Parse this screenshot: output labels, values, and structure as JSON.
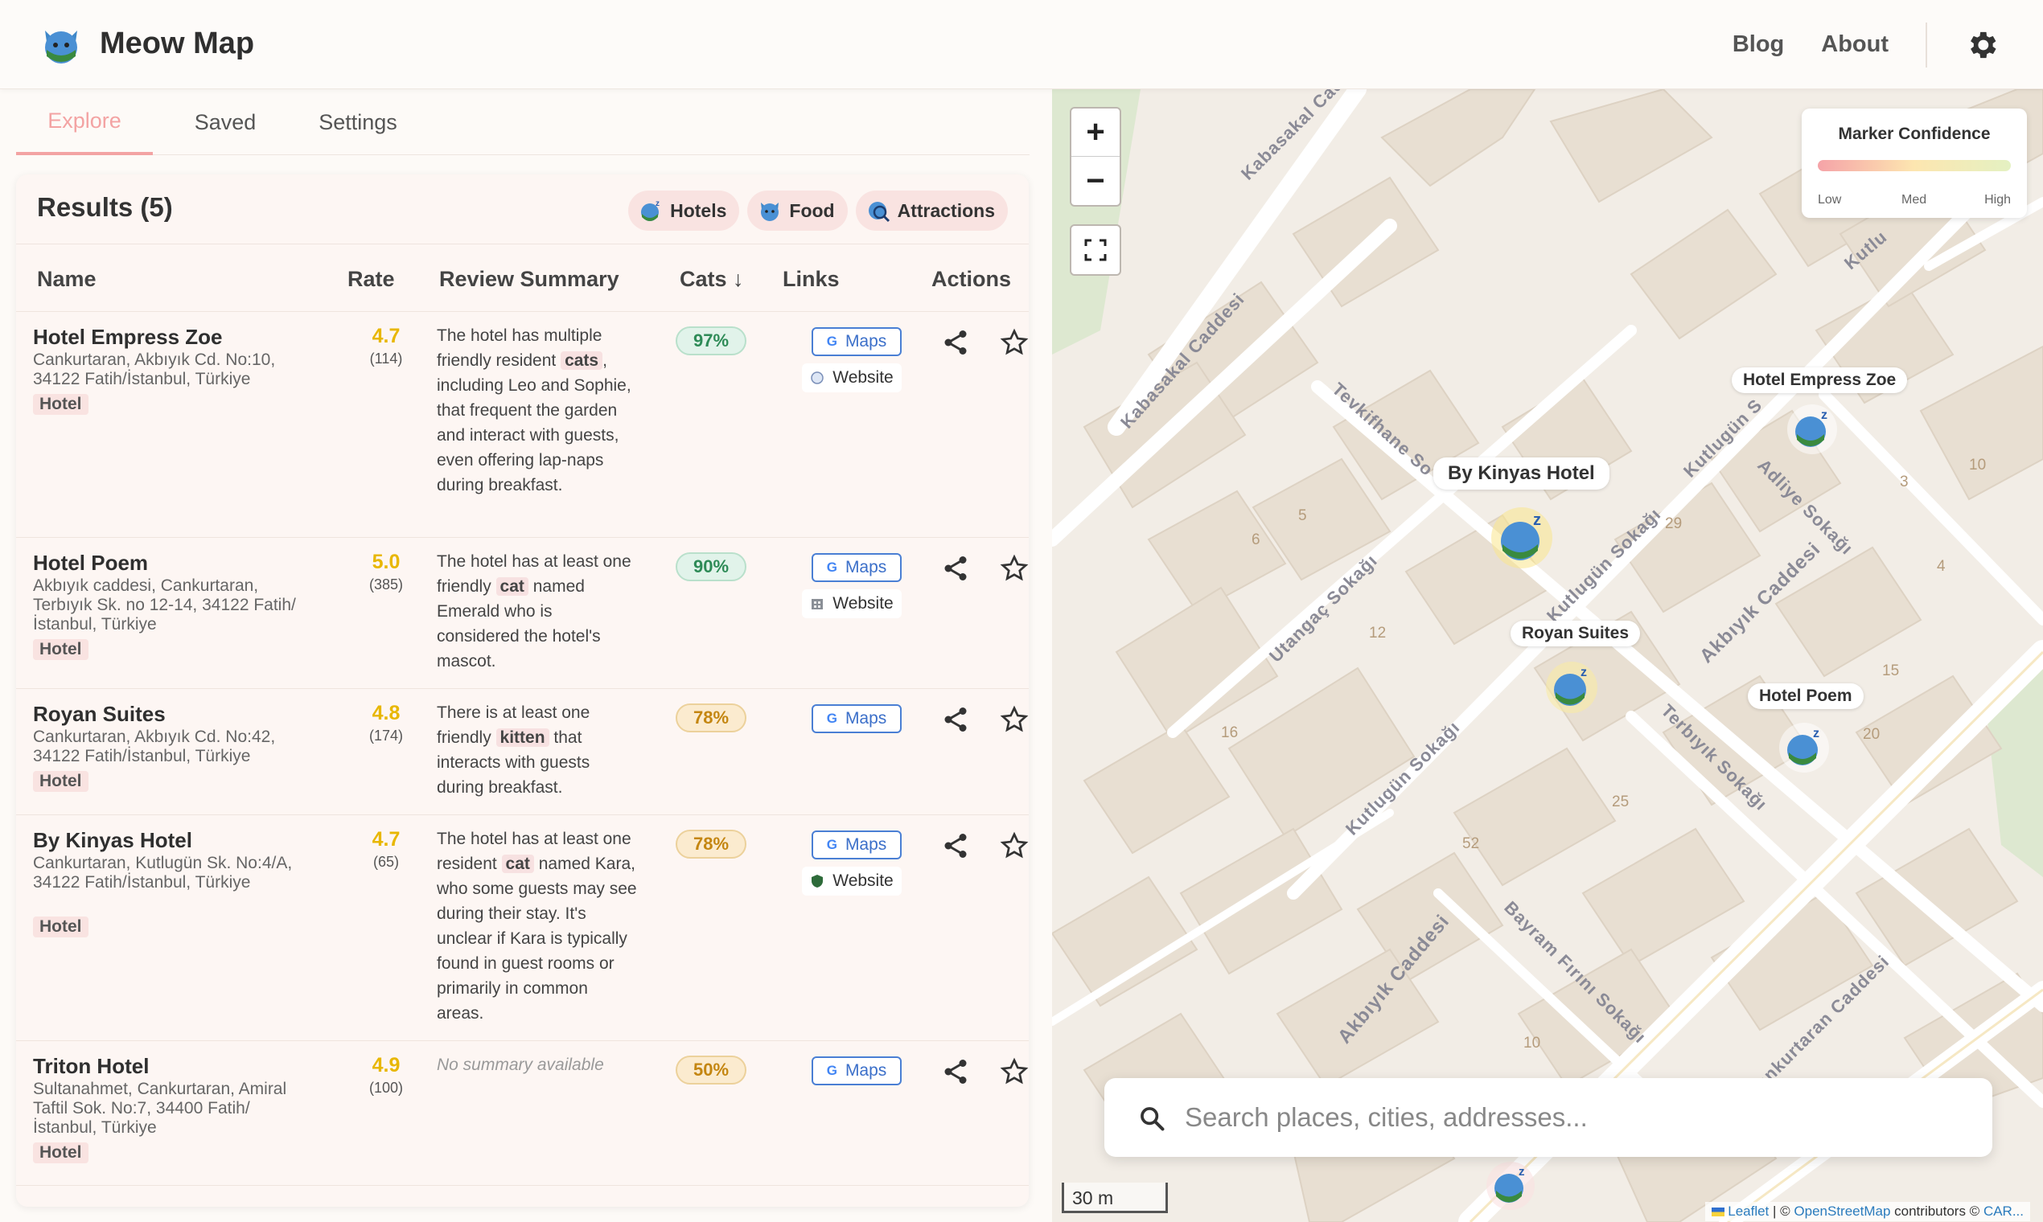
{
  "app": {
    "title": "Meow Map",
    "logo_icon": "cat-logo-icon"
  },
  "nav": {
    "blog": "Blog",
    "about": "About",
    "settings_icon": "gear-icon"
  },
  "tabs": [
    {
      "label": "Explore",
      "active": true
    },
    {
      "label": "Saved",
      "active": false
    },
    {
      "label": "Settings",
      "active": false
    }
  ],
  "results": {
    "title": "Results (5)",
    "filters": [
      {
        "label": "Hotels",
        "icon": "sleeping-cat-icon"
      },
      {
        "label": "Food",
        "icon": "cat-face-icon"
      },
      {
        "label": "Attractions",
        "icon": "cat-magnifier-icon"
      }
    ],
    "columns": {
      "name": "Name",
      "rate": "Rate",
      "summary": "Review Summary",
      "cats": "Cats ↓",
      "links": "Links",
      "actions": "Actions"
    },
    "rows": [
      {
        "name": "Hotel Empress Zoe",
        "address": "Cankurtaran, Akbıyık Cd. No:10, 34122 Fatih/İstanbul, Türkiye",
        "type": "Hotel",
        "rating": "4.7",
        "reviews": "(114)",
        "summary_before": "The hotel has multiple friendly resident ",
        "summary_keyword": "cats",
        "summary_after": ", including Leo and Sophie, that frequent the garden and interact with guests, even offering lap-naps during breakfast.",
        "cats_pct": "97%",
        "cats_level": "hi",
        "maps_label": "Maps",
        "website_label": "Website"
      },
      {
        "name": "Hotel Poem",
        "address": "Akbıyık caddesi, Cankurtaran, Terbıyık Sk. no 12-14, 34122 Fatih/İstanbul, Türkiye",
        "type": "Hotel",
        "rating": "5.0",
        "reviews": "(385)",
        "summary_before": "The hotel has at least one friendly ",
        "summary_keyword": "cat",
        "summary_after": " named Emerald who is considered the hotel's mascot.",
        "cats_pct": "90%",
        "cats_level": "hi",
        "maps_label": "Maps",
        "website_label": "Website"
      },
      {
        "name": "Royan Suites",
        "address": "Cankurtaran, Akbıyık Cd. No:42, 34122 Fatih/İstanbul, Türkiye",
        "type": "Hotel",
        "rating": "4.8",
        "reviews": "(174)",
        "summary_before": "There is at least one friendly ",
        "summary_keyword": "kitten",
        "summary_after": " that interacts with guests during breakfast.",
        "cats_pct": "78%",
        "cats_level": "mid",
        "maps_label": "Maps",
        "website_label": ""
      },
      {
        "name": "By Kinyas Hotel",
        "address": "Cankurtaran, Kutlugün Sk. No:4/A, 34122 Fatih/İstanbul, Türkiye",
        "type": "Hotel",
        "rating": "4.7",
        "reviews": "(65)",
        "summary_before": "The hotel has at least one resident ",
        "summary_keyword": "cat",
        "summary_after": " named Kara, who some guests may see during their stay. It's unclear if Kara is typically found in guest rooms or primarily in common areas.",
        "cats_pct": "78%",
        "cats_level": "mid",
        "maps_label": "Maps",
        "website_label": "Website"
      },
      {
        "name": "Triton Hotel",
        "address": "Sultanahmet, Cankurtaran, Amiral Taftil Sok. No:7, 34400 Fatih/ İstanbul, Türkiye",
        "type": "Hotel",
        "rating": "4.9",
        "reviews": "(100)",
        "summary_empty": "No summary available",
        "cats_pct": "50%",
        "cats_level": "mid",
        "maps_label": "Maps",
        "website_label": ""
      }
    ]
  },
  "map": {
    "zoom_in": "+",
    "zoom_out": "−",
    "legend": {
      "title": "Marker Confidence",
      "low": "Low",
      "med": "Med",
      "high": "High"
    },
    "markers": {
      "by_kinyas": "By Kinyas Hotel",
      "empress_zoe": "Hotel Empress Zoe",
      "royan": "Royan Suites",
      "poem": "Hotel Poem"
    },
    "streets": [
      "Kabasakal Caddesi",
      "Kabasakal Caddesi",
      "Tevkifhane So",
      "Kutlugün S",
      "Kutlugün Sokağı",
      "Kutlugün Sokağı",
      "Utangaç Sokağı",
      "Adliye Sokağı",
      "Akbıyık Caddesi",
      "Akbıyık Caddesi",
      "Terbıyık Sokağı",
      "Bayram Fırını Sokağı",
      "ankurtaran Caddesi",
      "Kutlu"
    ],
    "house_numbers": [
      "5",
      "6",
      "29",
      "3",
      "10",
      "4",
      "12",
      "15",
      "16",
      "20",
      "25",
      "52",
      "10"
    ],
    "search_placeholder": "Search places, cities, addresses...",
    "scale": "30 m",
    "attribution": {
      "leaflet": "Leaflet",
      "sep": " | © ",
      "osm": "OpenStreetMap",
      "contrib": " contributors © ",
      "carto": "CAR..."
    }
  }
}
